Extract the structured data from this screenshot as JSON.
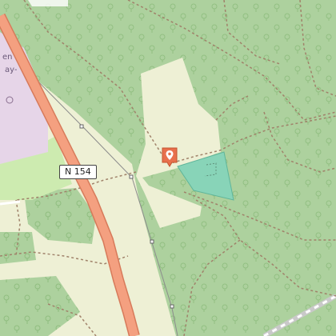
{
  "map": {
    "road_label": "N 154",
    "place_label_fragments": [
      "en",
      "ay-"
    ],
    "marker": {
      "icon": "location-pin-icon",
      "color": "#e8704d"
    },
    "colors": {
      "forest": "#add19e",
      "meadow": "#cdebb0",
      "clearing": "#eef0d5",
      "residential": "#e6d5e8",
      "water_area": "#88d4b8",
      "primary_road": "#f4a080",
      "primary_road_casing": "#d77a5a",
      "path": "#a0826a"
    }
  }
}
